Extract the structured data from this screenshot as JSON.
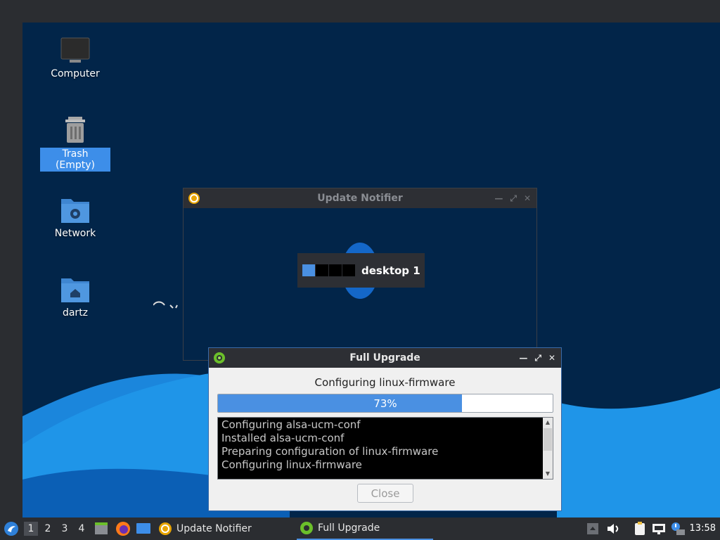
{
  "desktop": {
    "icons": [
      {
        "label": "Computer",
        "icon": "computer-icon"
      },
      {
        "label": "Trash (Empty)",
        "icon": "trash-icon",
        "selected": true
      },
      {
        "label": "Network",
        "icon": "network-folder-icon"
      },
      {
        "label": "dartz",
        "icon": "home-folder-icon"
      }
    ]
  },
  "update_notifier": {
    "title": "Update Notifier"
  },
  "workspace_popup": {
    "label": "desktop 1",
    "active_index": 0
  },
  "full_upgrade": {
    "title": "Full Upgrade",
    "status": "Configuring linux-firmware",
    "progress": 0.73,
    "progress_label": "73%",
    "log": [
      "Configuring alsa-ucm-conf",
      "Installed alsa-ucm-conf",
      "Preparing configuration of linux-firmware",
      "Configuring linux-firmware"
    ],
    "close_label": "Close"
  },
  "taskbar": {
    "workspaces": [
      "1",
      "2",
      "3",
      "4"
    ],
    "tasks": [
      {
        "label": "Update Notifier",
        "icon": "update-icon"
      },
      {
        "label": "Full Upgrade",
        "icon": "gear-icon",
        "active": true
      }
    ],
    "clock": "13:58"
  },
  "colors": {
    "desktop_bg": "#022549",
    "wave_light": "#1e90e8",
    "accent": "#4a90e2"
  }
}
